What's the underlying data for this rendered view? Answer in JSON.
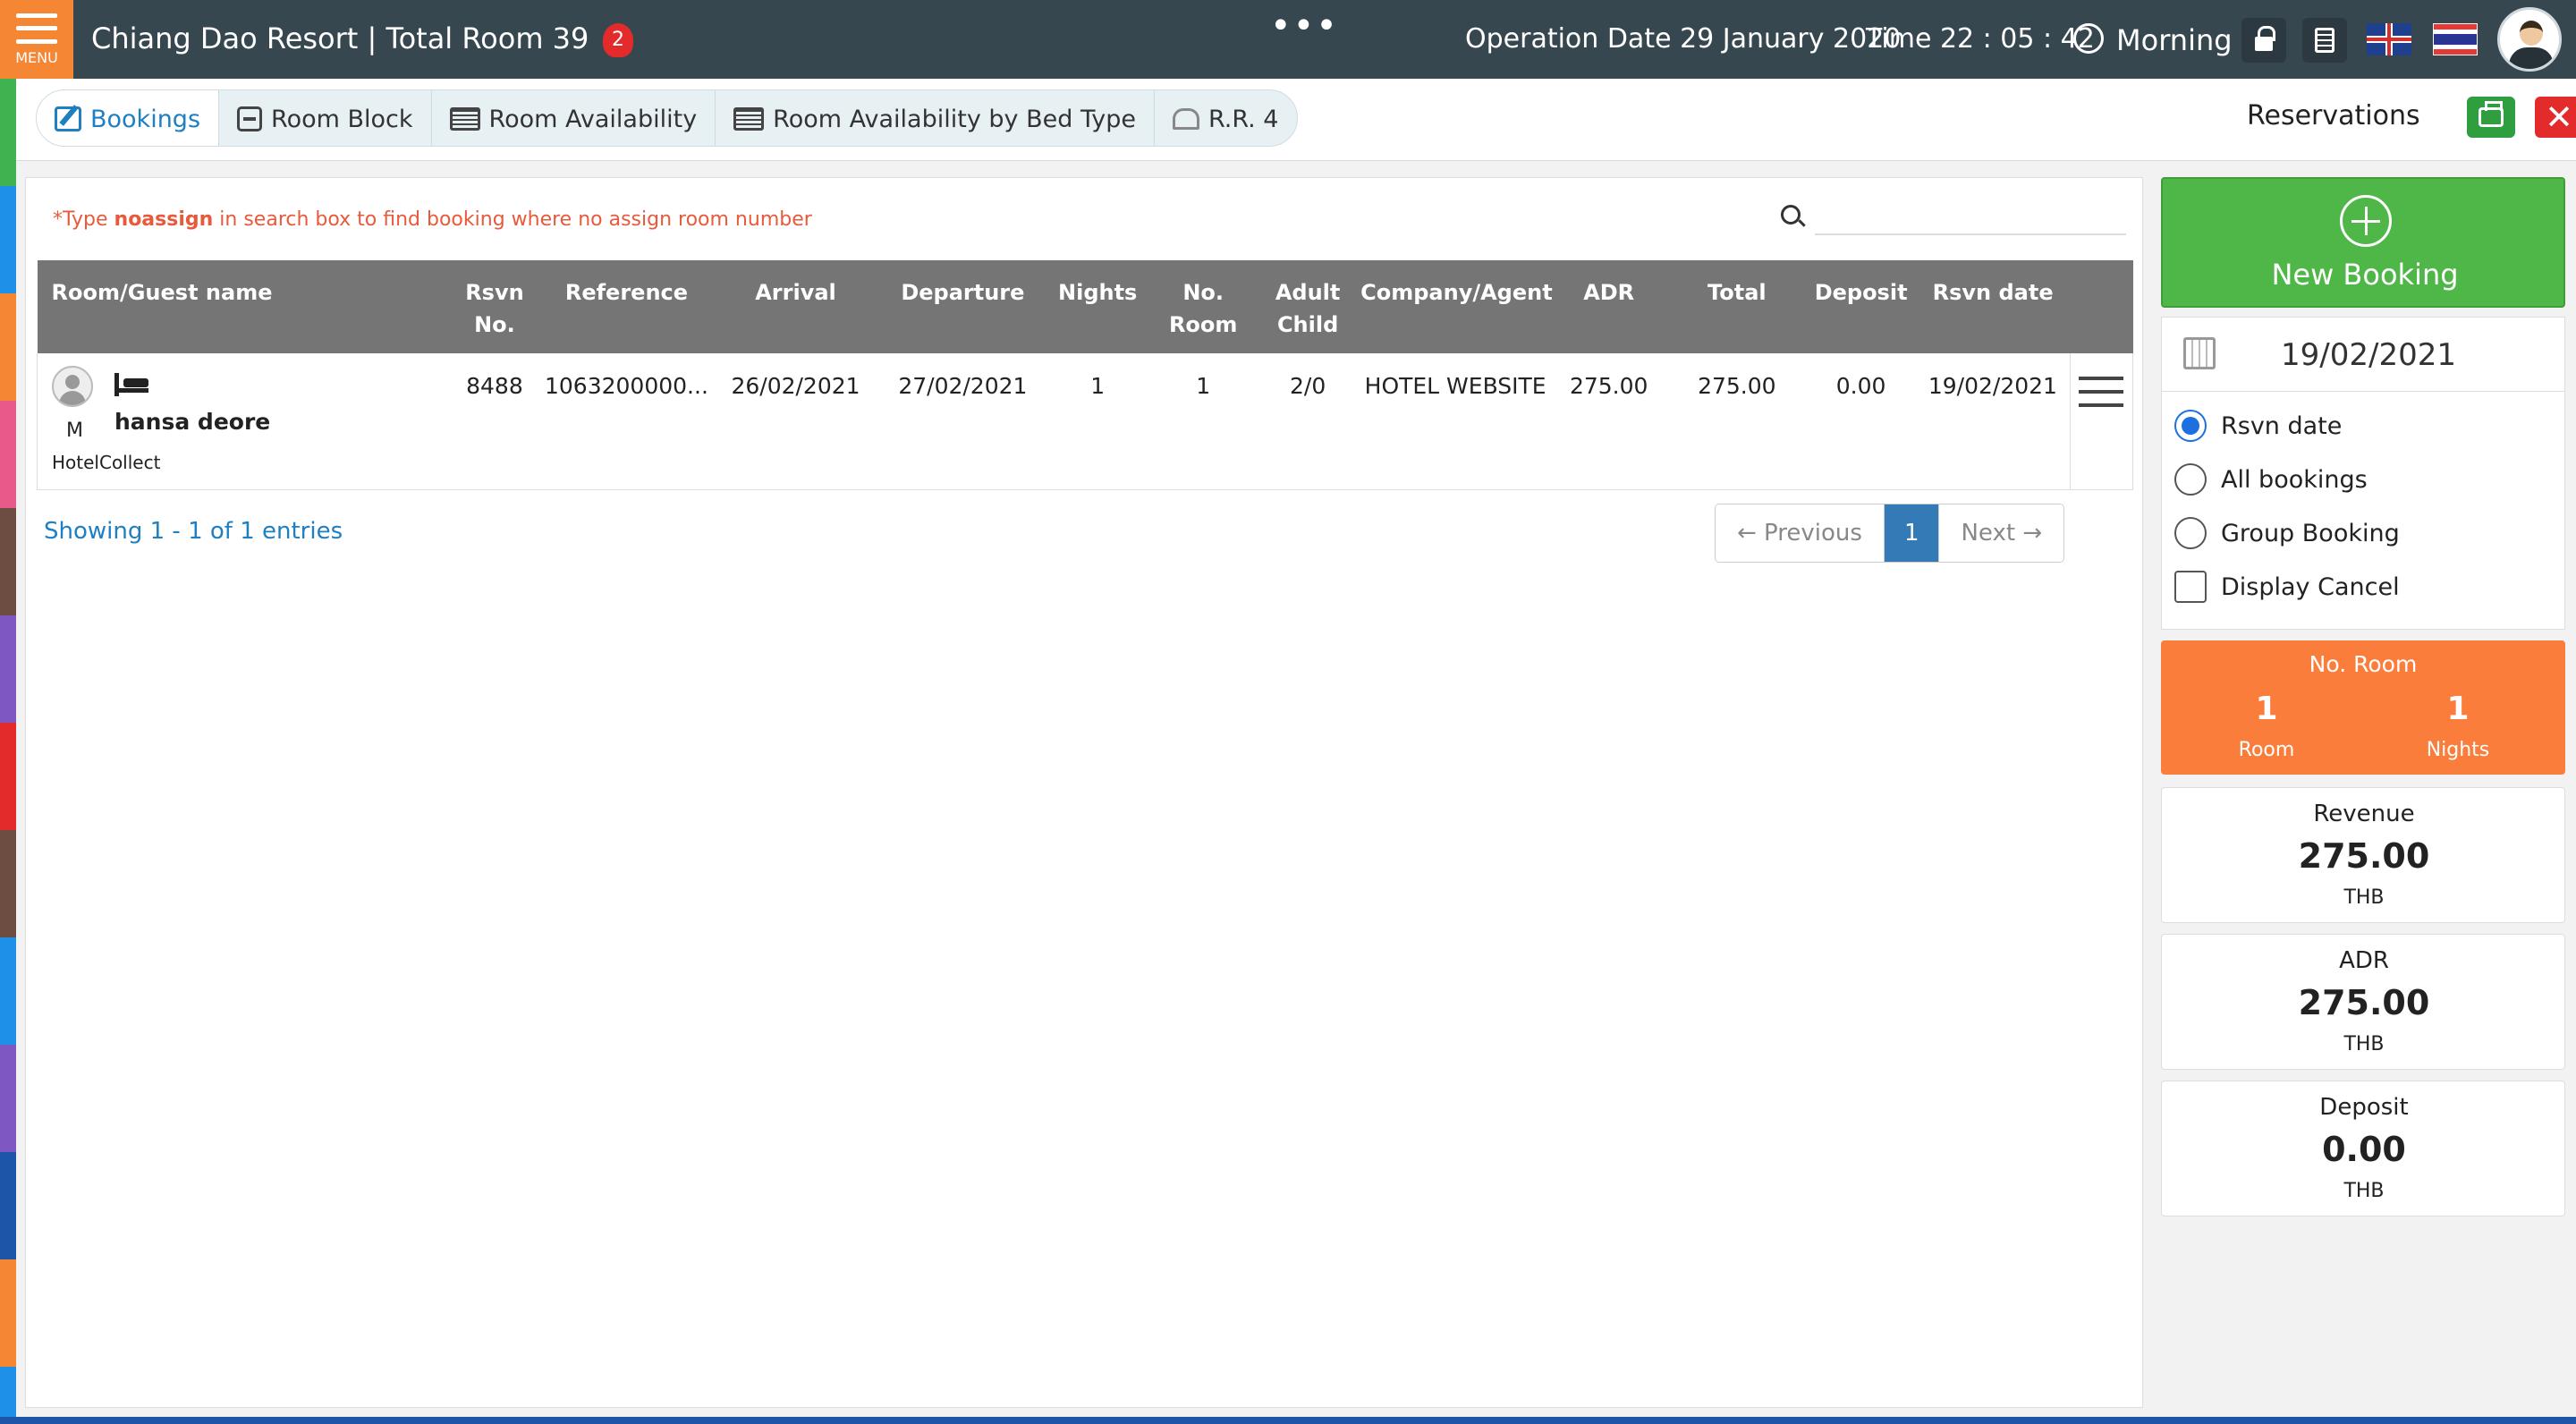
{
  "header": {
    "menu_label": "MENU",
    "hotel_title": "Chiang Dao Resort | Total Room 39",
    "notification_count": "2",
    "more": "•••",
    "operation_date": "Operation Date 29 January 2020",
    "time": "Time 22 : 05 : 42",
    "shift": "Morning"
  },
  "tabs": [
    {
      "label": "Bookings",
      "icon": "edit-icon",
      "active": true
    },
    {
      "label": "Room Block",
      "icon": "block-icon"
    },
    {
      "label": "Room Availability",
      "icon": "list-icon"
    },
    {
      "label": "Room Availability by Bed Type",
      "icon": "list-icon"
    },
    {
      "label": "R.R. 4",
      "icon": "users-icon"
    }
  ],
  "page_title": "Reservations",
  "search": {
    "hint_prefix": "*Type ",
    "hint_keyword": "noassign",
    "hint_suffix": " in search box to find booking where no assign room number",
    "value": ""
  },
  "table": {
    "headers": {
      "guest": "Room/Guest name",
      "rsvn_no_1": "Rsvn",
      "rsvn_no_2": "No.",
      "reference": "Reference",
      "arrival": "Arrival",
      "departure": "Departure",
      "nights": "Nights",
      "no_room_1": "No.",
      "no_room_2": "Room",
      "adult_1": "Adult",
      "adult_2": "Child",
      "company": "Company/Agent",
      "adr": "ADR",
      "total": "Total",
      "deposit": "Deposit",
      "rsvn_date": "Rsvn date"
    },
    "rows": [
      {
        "title": "M",
        "name": "hansa deore",
        "source": "HotelCollect",
        "rsvn_no": "8488",
        "reference": "1063200000...",
        "arrival": "26/02/2021",
        "departure": "27/02/2021",
        "nights": "1",
        "no_room": "1",
        "adult_child": "2/0",
        "company": "HOTEL WEBSITE",
        "adr": "275.00",
        "total": "275.00",
        "deposit": "0.00",
        "rsvn_date": "19/02/2021"
      }
    ]
  },
  "pagination": {
    "showing": "Showing 1 - 1 of 1 entries",
    "previous": "← Previous",
    "current": "1",
    "next": "Next →"
  },
  "side": {
    "new_booking": "New Booking",
    "date": "19/02/2021",
    "options": {
      "rsvn_date": "Rsvn date",
      "all_bookings": "All bookings",
      "group_booking": "Group Booking",
      "display_cancel": "Display Cancel"
    },
    "selected_option": "rsvn_date",
    "no_room": {
      "title": "No. Room",
      "rooms": "1",
      "rooms_label": "Room",
      "nights": "1",
      "nights_label": "Nights"
    },
    "revenue": {
      "title": "Revenue",
      "value": "275.00",
      "unit": "THB"
    },
    "adr": {
      "title": "ADR",
      "value": "275.00",
      "unit": "THB"
    },
    "deposit": {
      "title": "Deposit",
      "value": "0.00",
      "unit": "THB"
    }
  },
  "colors": {
    "topbar": "#37474f",
    "menu": "#f58634",
    "accent": "#1e7fc2",
    "new_booking": "#4fb748",
    "no_room": "#fb7d3b",
    "stripe": [
      "#3fb34f",
      "#1e90e8",
      "#f58634",
      "#e85a8a",
      "#6d4c41",
      "#7e57c2",
      "#e32b2b",
      "#6d4c41",
      "#1e90e8",
      "#7e57c2",
      "#1d55a8",
      "#f58634",
      "#1e90e8"
    ]
  }
}
